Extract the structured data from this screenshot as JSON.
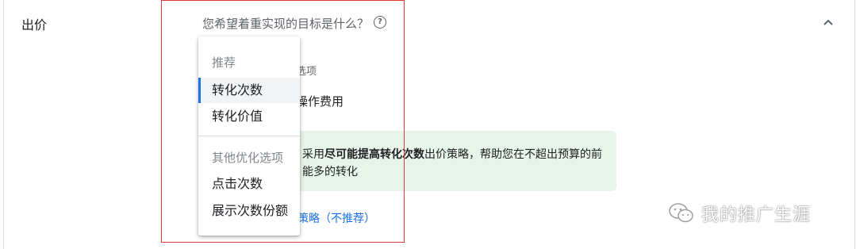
{
  "section": {
    "title": "出价"
  },
  "question": {
    "text": "您希望着重实现的目标是什么？",
    "help_icon": "help-circle-icon"
  },
  "background": {
    "option_label": "选项",
    "option_value": "操作费用",
    "recommendation_prefix": "采用",
    "recommendation_bold": "尽可能提高转化次数",
    "recommendation_suffix": "出价策略，帮助您在不超出预算的前",
    "recommendation_line2": "能多的转化",
    "strategy_link": "策略（不推荐）"
  },
  "dropdown": {
    "group_recommended": "推荐",
    "recommended_items": [
      "转化次数",
      "转化价值"
    ],
    "selected_index": 0,
    "group_other": "其他优化选项",
    "other_items": [
      "点击次数",
      "展示次数份额"
    ]
  },
  "watermark": {
    "text": "我的推广生涯"
  },
  "colors": {
    "accent": "#1a73e8",
    "annotation": "#e53935",
    "recommend_bg": "#e6f4ea"
  }
}
